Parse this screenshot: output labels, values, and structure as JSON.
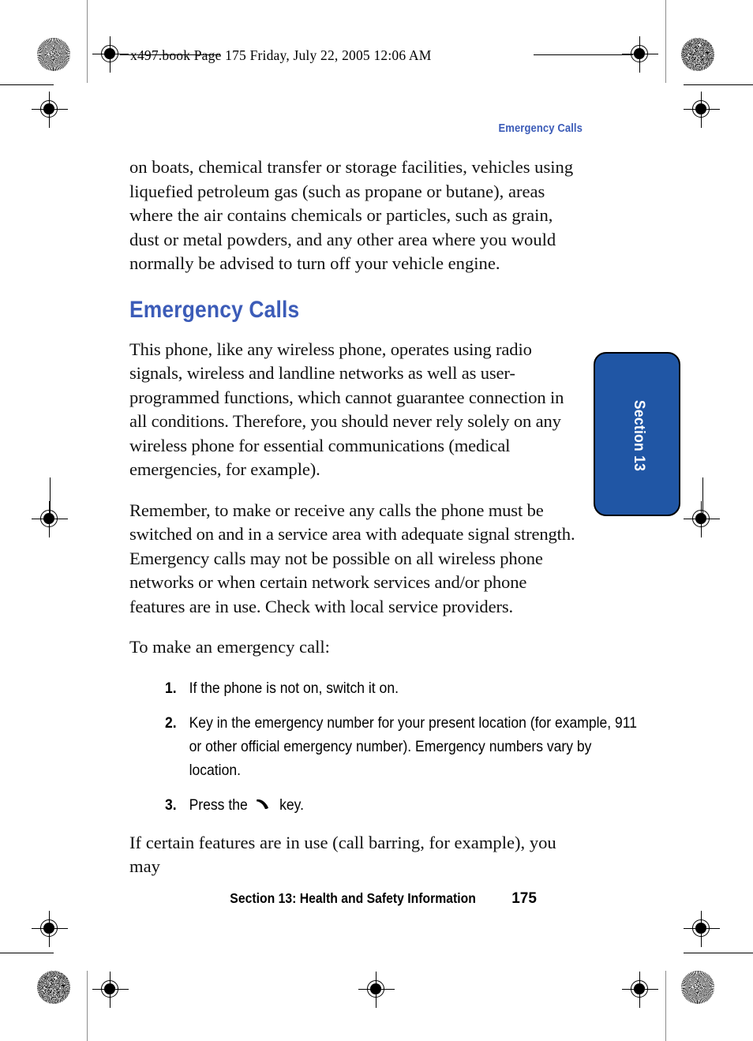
{
  "print_header": "x497.book  Page 175  Friday, July 22, 2005  12:06 AM",
  "running_head": "Emergency Calls",
  "colors": {
    "heading_blue": "#3c5cb8",
    "tab_blue": "#2056a5",
    "tab_outline": "#000000",
    "body_text": "#111111"
  },
  "content": {
    "intro_paragraph": "on boats, chemical transfer or storage facilities, vehicles using liquefied petroleum gas (such as propane or butane), areas where the air contains chemicals or particles, such as grain, dust or metal powders, and any other area where you would normally be advised to turn off your vehicle engine.",
    "section_title": "Emergency Calls",
    "paragraph_1": "This phone, like any wireless phone, operates using radio signals, wireless and landline networks as well as user-programmed functions, which cannot guarantee connection in all conditions. Therefore, you should never rely solely on any wireless phone for essential communications (medical emergencies, for example).",
    "paragraph_2": "Remember, to make or receive any calls the phone must be switched on and in a service area with adequate signal strength. Emergency calls may not be possible on all wireless phone networks or when certain network services and/or phone features are in use. Check with local service providers.",
    "lead_in": "To make an emergency call:",
    "steps": [
      {
        "num": "1.",
        "text_before": "If the phone is not on, switch it on.",
        "icon": null,
        "text_after": ""
      },
      {
        "num": "2.",
        "text_before": "Key in the emergency number for your present location (for example, 911 or other official emergency number). Emergency numbers vary by location.",
        "icon": null,
        "text_after": ""
      },
      {
        "num": "3.",
        "text_before": "Press the",
        "icon": "send-key-icon",
        "text_after": "key."
      }
    ],
    "closing_paragraph": "If certain features are in use (call barring, for example), you may"
  },
  "thumb_tab": {
    "label": "Section 13"
  },
  "footer": {
    "title": "Section 13: Health and Safety Information",
    "page_number": "175"
  }
}
